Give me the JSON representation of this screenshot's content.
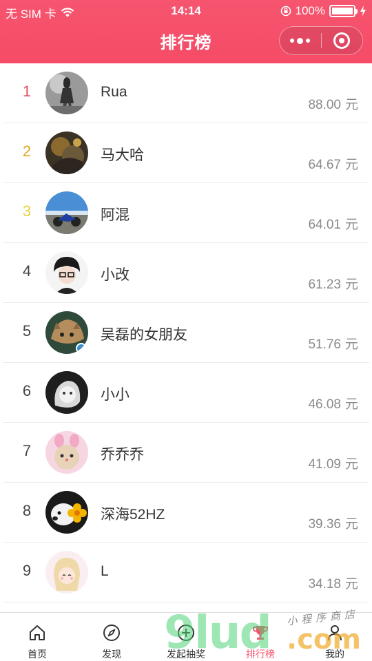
{
  "status_bar": {
    "carrier": "无 SIM 卡",
    "time": "14:14",
    "battery": "100%",
    "battery_level": 1.0
  },
  "nav": {
    "title": "排行榜",
    "more_icon": "more-dots-icon",
    "close_icon": "target-circle-icon"
  },
  "ranking": [
    {
      "rank": "1",
      "name": "Rua",
      "amount": "88.00",
      "unit": "元"
    },
    {
      "rank": "2",
      "name": "马大哈",
      "amount": "64.67",
      "unit": "元"
    },
    {
      "rank": "3",
      "name": "阿混",
      "amount": "64.01",
      "unit": "元"
    },
    {
      "rank": "4",
      "name": "小改",
      "amount": "61.23",
      "unit": "元"
    },
    {
      "rank": "5",
      "name": "吴磊的女朋友",
      "amount": "51.76",
      "unit": "元"
    },
    {
      "rank": "6",
      "name": "小小",
      "amount": "46.08",
      "unit": "元"
    },
    {
      "rank": "7",
      "name": "乔乔乔",
      "amount": "41.09",
      "unit": "元"
    },
    {
      "rank": "8",
      "name": "深海52HZ",
      "amount": "39.36",
      "unit": "元"
    },
    {
      "rank": "9",
      "name": "L",
      "amount": "34.18",
      "unit": "元"
    }
  ],
  "tabbar": {
    "items": [
      {
        "label": "首页",
        "icon": "home-icon"
      },
      {
        "label": "发现",
        "icon": "compass-icon"
      },
      {
        "label": "发起抽奖",
        "icon": "plus-circle-icon"
      },
      {
        "label": "排行榜",
        "icon": "trophy-icon"
      },
      {
        "label": "我的",
        "icon": "user-icon"
      }
    ],
    "active_index": 3
  },
  "watermark": {
    "main": "9lud",
    "com": ".com",
    "small": "小程序商店"
  },
  "colors": {
    "brand": "#f54b67",
    "rank1": "#e84a5f",
    "rank2": "#e3a722",
    "rank3": "#e8d23a",
    "amount": "#8a8a8a"
  }
}
